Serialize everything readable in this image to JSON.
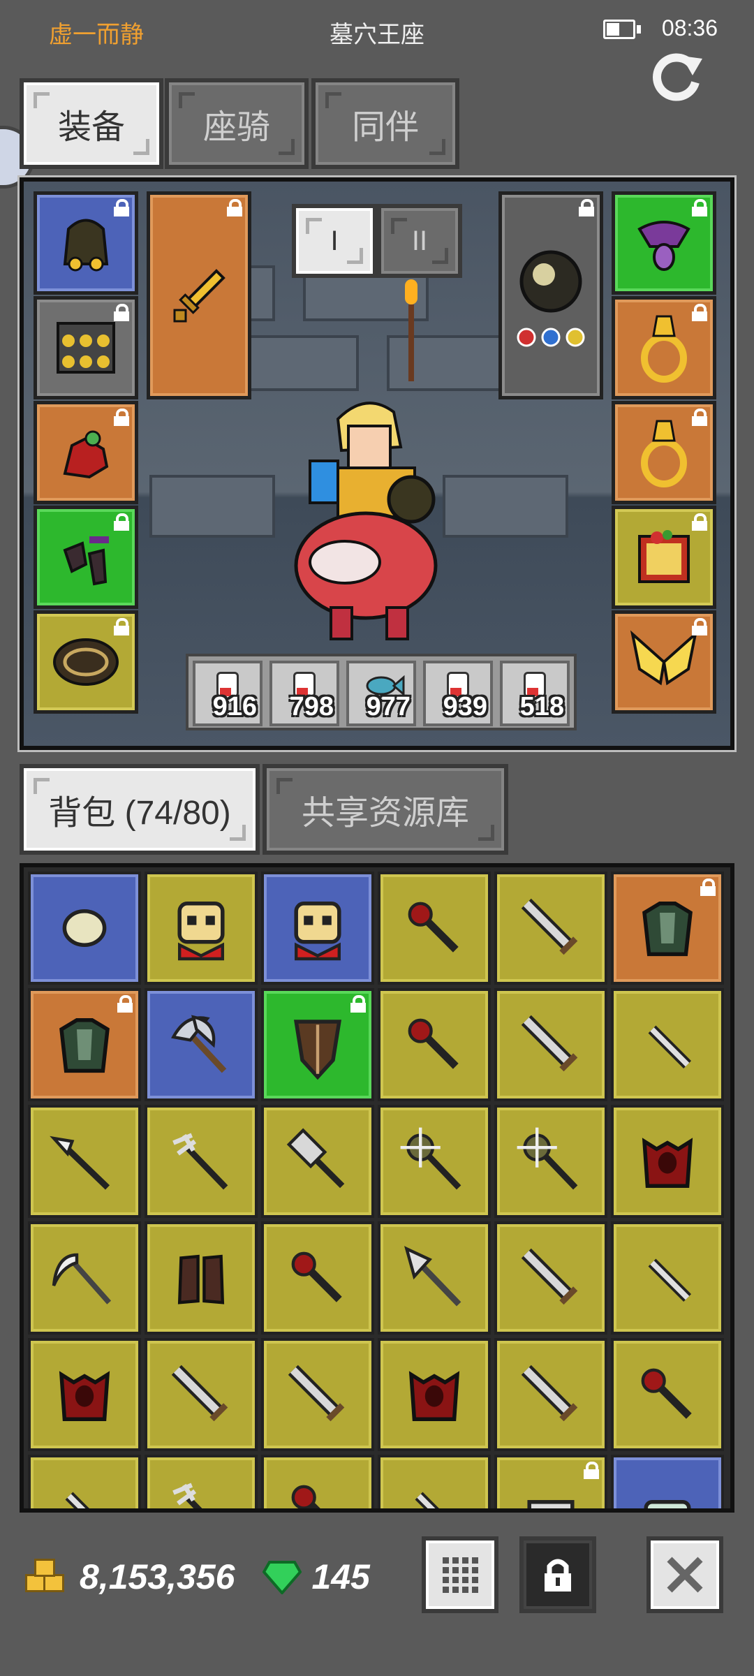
{
  "status_bar": {
    "player_name": "虚一而静",
    "location": "墓穴王座",
    "time": "08:36"
  },
  "top_tabs": [
    {
      "label": "装备",
      "active": true
    },
    {
      "label": "座骑",
      "active": false
    },
    {
      "label": "同伴",
      "active": false
    }
  ],
  "weapon_sets": [
    "I",
    "II"
  ],
  "equipment": {
    "left_column": [
      {
        "slot": "helmet",
        "rarity": "blue",
        "icon": "hood-icon"
      },
      {
        "slot": "armor",
        "rarity": "gray",
        "icon": "chainmail-icon"
      },
      {
        "slot": "gloves",
        "rarity": "orange",
        "icon": "glove-icon"
      },
      {
        "slot": "boots",
        "rarity": "green",
        "icon": "boots-icon"
      },
      {
        "slot": "belt",
        "rarity": "yellow",
        "icon": "belt-icon"
      }
    ],
    "main_hand": {
      "rarity": "orange",
      "icon": "dagger-icon"
    },
    "off_hand": {
      "rarity": "gray",
      "icon": "orb-icon"
    },
    "right_column": [
      {
        "slot": "amulet",
        "rarity": "green",
        "icon": "amulet-icon"
      },
      {
        "slot": "ring-1",
        "rarity": "orange",
        "icon": "ring-icon"
      },
      {
        "slot": "ring-2",
        "rarity": "orange",
        "icon": "ring-icon"
      },
      {
        "slot": "book",
        "rarity": "yellow",
        "icon": "book-icon"
      },
      {
        "slot": "wings",
        "rarity": "orange",
        "icon": "wings-icon"
      }
    ]
  },
  "potions": [
    {
      "icon": "potion-icon",
      "count": "916"
    },
    {
      "icon": "potion-icon",
      "count": "798"
    },
    {
      "icon": "fish-icon",
      "count": "977"
    },
    {
      "icon": "potion-icon",
      "count": "939"
    },
    {
      "icon": "potion-icon",
      "count": "518"
    }
  ],
  "inventory_tabs": [
    {
      "label": "背包 (74/80)",
      "active": true
    },
    {
      "label": "共享资源库",
      "active": false
    }
  ],
  "inventory": [
    {
      "r": "blue",
      "icon": "stone-icon",
      "lock": false
    },
    {
      "r": "yellow",
      "icon": "skull-icon",
      "lock": false
    },
    {
      "r": "blue",
      "icon": "skull-icon",
      "lock": false
    },
    {
      "r": "yellow",
      "icon": "mace-icon",
      "lock": false
    },
    {
      "r": "yellow",
      "icon": "sword-icon",
      "lock": false
    },
    {
      "r": "orange",
      "icon": "armor-icon",
      "lock": true
    },
    {
      "r": "orange",
      "icon": "armor-icon",
      "lock": true
    },
    {
      "r": "blue",
      "icon": "axe-icon",
      "lock": false
    },
    {
      "r": "green",
      "icon": "shield-icon",
      "lock": true
    },
    {
      "r": "yellow",
      "icon": "mace-icon",
      "lock": false
    },
    {
      "r": "yellow",
      "icon": "sword-icon",
      "lock": false
    },
    {
      "r": "yellow",
      "icon": "knife-icon",
      "lock": false
    },
    {
      "r": "yellow",
      "icon": "spear-icon",
      "lock": false
    },
    {
      "r": "yellow",
      "icon": "trident-icon",
      "lock": false
    },
    {
      "r": "yellow",
      "icon": "hammer-icon",
      "lock": false
    },
    {
      "r": "yellow",
      "icon": "morningstar-icon",
      "lock": false
    },
    {
      "r": "yellow",
      "icon": "morningstar-icon",
      "lock": false
    },
    {
      "r": "yellow",
      "icon": "demon-armor-icon",
      "lock": false
    },
    {
      "r": "yellow",
      "icon": "scythe-icon",
      "lock": false
    },
    {
      "r": "yellow",
      "icon": "boots-icon",
      "lock": false
    },
    {
      "r": "yellow",
      "icon": "mace-icon",
      "lock": false
    },
    {
      "r": "yellow",
      "icon": "halberd-icon",
      "lock": false
    },
    {
      "r": "yellow",
      "icon": "sword-icon",
      "lock": false
    },
    {
      "r": "yellow",
      "icon": "knife-icon",
      "lock": false
    },
    {
      "r": "yellow",
      "icon": "demon-armor-icon",
      "lock": false
    },
    {
      "r": "yellow",
      "icon": "sword-icon",
      "lock": false
    },
    {
      "r": "yellow",
      "icon": "sword-icon",
      "lock": false
    },
    {
      "r": "yellow",
      "icon": "demon-armor-icon",
      "lock": false
    },
    {
      "r": "yellow",
      "icon": "sword-icon",
      "lock": false
    },
    {
      "r": "yellow",
      "icon": "mace-icon",
      "lock": false
    },
    {
      "r": "yellow",
      "icon": "knife-icon",
      "lock": false
    },
    {
      "r": "yellow",
      "icon": "trident-icon",
      "lock": false
    },
    {
      "r": "yellow",
      "icon": "mace-icon",
      "lock": false
    },
    {
      "r": "yellow",
      "icon": "knife-icon",
      "lock": false
    },
    {
      "r": "yellow",
      "icon": "helmet-icon",
      "lock": true
    },
    {
      "r": "blue",
      "icon": "scroll-icon",
      "lock": false
    }
  ],
  "currency": {
    "gold": "8,153,356",
    "gems": "145"
  },
  "colors": {
    "yellow": "#b3a935",
    "blue": "#4d63b8",
    "orange": "#c97838",
    "green": "#2db82d",
    "gray": "#6f6f6f",
    "accent_name": "#f0a030"
  }
}
